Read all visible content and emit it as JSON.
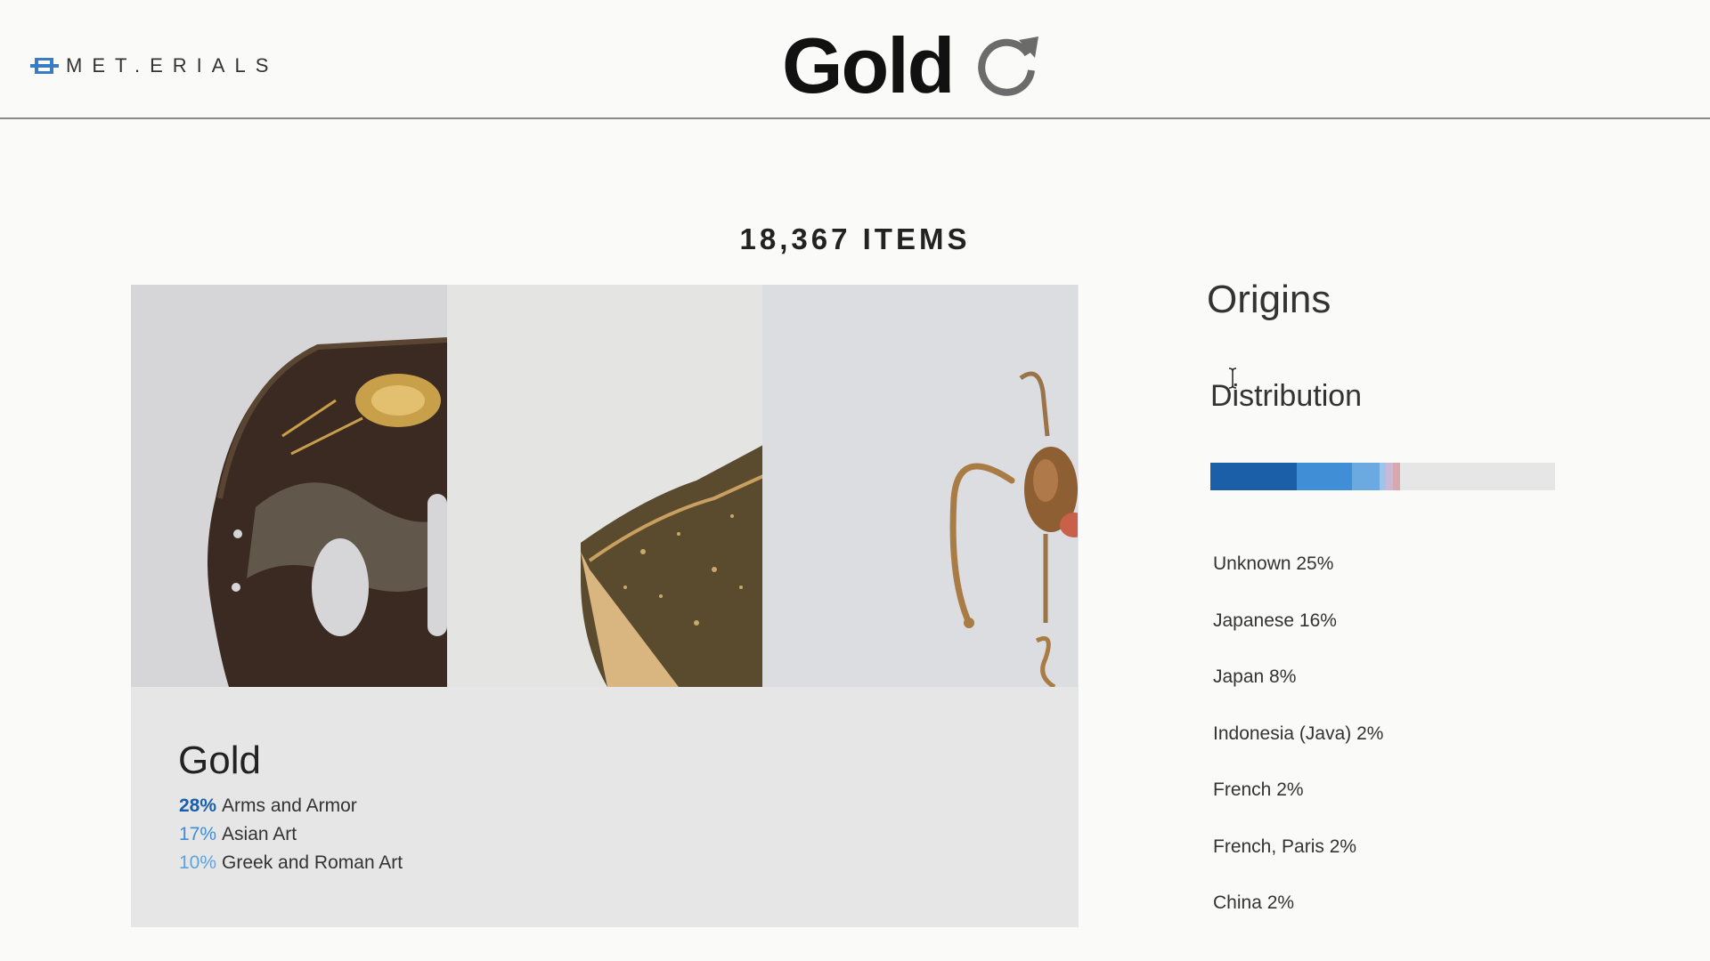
{
  "header": {
    "logo_text": "MET.ERIALS",
    "title": "Gold",
    "refresh_icon": "refresh-icon"
  },
  "summary": {
    "items_count": "18,367 ITEMS"
  },
  "card": {
    "title": "Gold",
    "thumbnails": [
      "sword-guard-image",
      "lacquer-box-image",
      "gold-earring-image"
    ],
    "departments": [
      {
        "pct": "28%",
        "label": "Arms and Armor",
        "color": "#1a5fa8"
      },
      {
        "pct": "17%",
        "label": "Asian Art",
        "color": "#3f8ed6"
      },
      {
        "pct": "10%",
        "label": "Greek and Roman Art",
        "color": "#5ea3e0"
      }
    ]
  },
  "origins": {
    "title": "Origins",
    "distribution_title": "Distribution",
    "distribution": [
      {
        "share": 25,
        "color": "#1a5fa8"
      },
      {
        "share": 16,
        "color": "#3f8ed6"
      },
      {
        "share": 8,
        "color": "#6aaae0"
      },
      {
        "share": 2,
        "color": "#9fc4e8"
      },
      {
        "share": 2,
        "color": "#c9b9d6"
      },
      {
        "share": 2,
        "color": "#d8a8b0"
      },
      {
        "share": 45,
        "color": "#e6e6e6"
      }
    ],
    "items": [
      "Unknown 25%",
      "Japanese 16%",
      "Japan 8%",
      "Indonesia (Java) 2%",
      "French 2%",
      "French, Paris 2%",
      "China 2%"
    ]
  }
}
